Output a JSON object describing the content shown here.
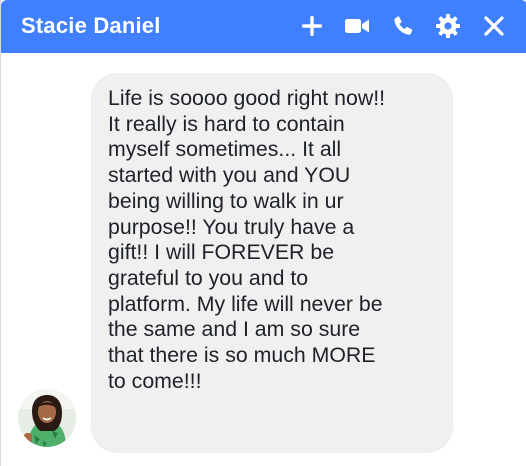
{
  "header": {
    "title": "Stacie Daniel",
    "background": "#4080ff",
    "icons": [
      "plus-icon",
      "video-camera-icon",
      "phone-icon",
      "gear-icon",
      "close-icon"
    ]
  },
  "message": {
    "text": "Life is soooo good right now!!\nIt really is hard to contain\nmyself sometimes... It all\nstarted with you and YOU\nbeing willing to walk in ur\npurpose!! You truly have a\ngift!!  I will FOREVER be\ngrateful to you and to\nplatform. My life will never be\nthe same and I am so sure\nthat there is so much MORE\nto come!!!",
    "bubble_color": "#f1f0f0"
  }
}
